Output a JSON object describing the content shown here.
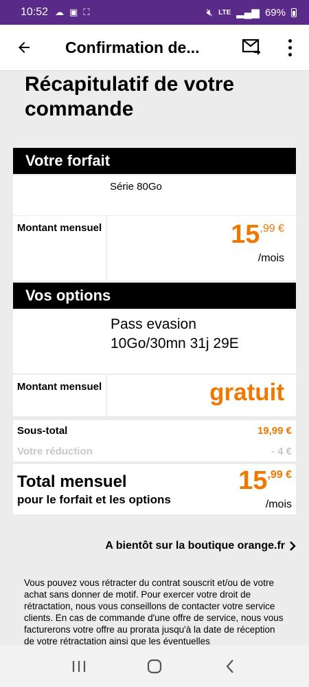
{
  "status_bar": {
    "time": "10:52",
    "network": "LTE",
    "battery": "69%"
  },
  "app_bar": {
    "title": "Confirmation de..."
  },
  "page": {
    "heading": "Récapitulatif de votre commande"
  },
  "forfait": {
    "header": "Votre forfait",
    "name": "Série 80Go",
    "amount_label": "Montant mensuel",
    "price_int": "15",
    "price_dec": ",99 €",
    "per": "/mois"
  },
  "options": {
    "header": "Vos options",
    "name": "Pass evasion 10Go/30mn 31j 29E",
    "amount_label": "Montant mensuel",
    "price_text": "gratuit"
  },
  "summary": {
    "subtotal_label": "Sous-total",
    "subtotal_value": "19,99 €",
    "discount_label": "Votre réduction",
    "discount_value": "- 4 €",
    "total_label": "Total mensuel",
    "total_sublabel": "pour le forfait et les options",
    "total_int": "15",
    "total_dec": ",99 €",
    "total_per": "/mois"
  },
  "footer": {
    "link": "A bientôt sur la boutique orange.fr",
    "legal": "Vous pouvez vous rétracter du contrat souscrit et/ou de votre achat sans donner de motif. Pour exercer votre droit de rétractation, nous vous conseillons de contacter votre service clients. En cas de commande d'une offre de service, nous vous facturerons votre offre au prorata jusqu'à la date de réception de votre rétractation ainsi que les éventuelles"
  },
  "colors": {
    "accent": "#f07800",
    "status_bar": "#5a2a88"
  }
}
